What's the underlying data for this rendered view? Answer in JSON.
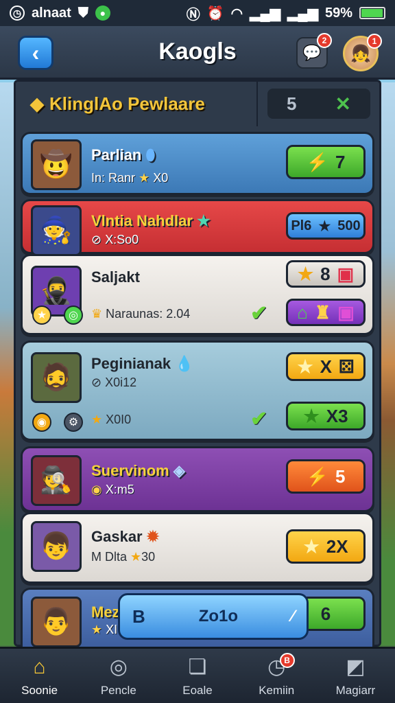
{
  "status_bar": {
    "carrier": "alnaat",
    "battery_percent_label": "59%",
    "battery_level": 0.9
  },
  "header": {
    "title": "Kaogls",
    "chat_badge": "2",
    "profile_badge": "1"
  },
  "filter": {
    "title": "KlinglAo Pewlaare",
    "count": "5"
  },
  "cards": [
    {
      "name": "Parlian",
      "sub": "In: Ranr",
      "sub2": "X0",
      "pill": "7"
    },
    {
      "name": "Vlntia Nahdlar",
      "sub": "X:So0",
      "pill": "Pl6",
      "pill2": "500"
    },
    {
      "name": "Saljakt",
      "sub": "Naraunas: 2.04",
      "pill": "8"
    },
    {
      "name": "Peginianak",
      "sub": "X0i12",
      "sub2": "X0I0",
      "pill": "X",
      "pill2": "X3"
    },
    {
      "name": "Suervinom",
      "sub": "X:m5",
      "pill": "5"
    },
    {
      "name": "Gaskar",
      "sub": "M Dlta",
      "sub2": "30",
      "pill": "2X"
    },
    {
      "name": "Mez",
      "sub": "XI",
      "pill": "6"
    }
  ],
  "popup": {
    "left": "B",
    "value": "Zo1o"
  },
  "nav": [
    {
      "label": "Soonie",
      "active": true
    },
    {
      "label": "Pencle"
    },
    {
      "label": "Eoale"
    },
    {
      "label": "Kemiin",
      "badge": "B"
    },
    {
      "label": "Magiarr"
    }
  ],
  "icons": {
    "back": "chevron-left-icon",
    "chat": "chat-icon",
    "star": "star-icon",
    "lightning": "lightning-icon",
    "check": "check-icon"
  },
  "colors": {
    "accent_yellow": "#f6d13b",
    "green_pill": "#3da82a",
    "red_card": "#c62f33",
    "purple_card": "#6d3294"
  }
}
